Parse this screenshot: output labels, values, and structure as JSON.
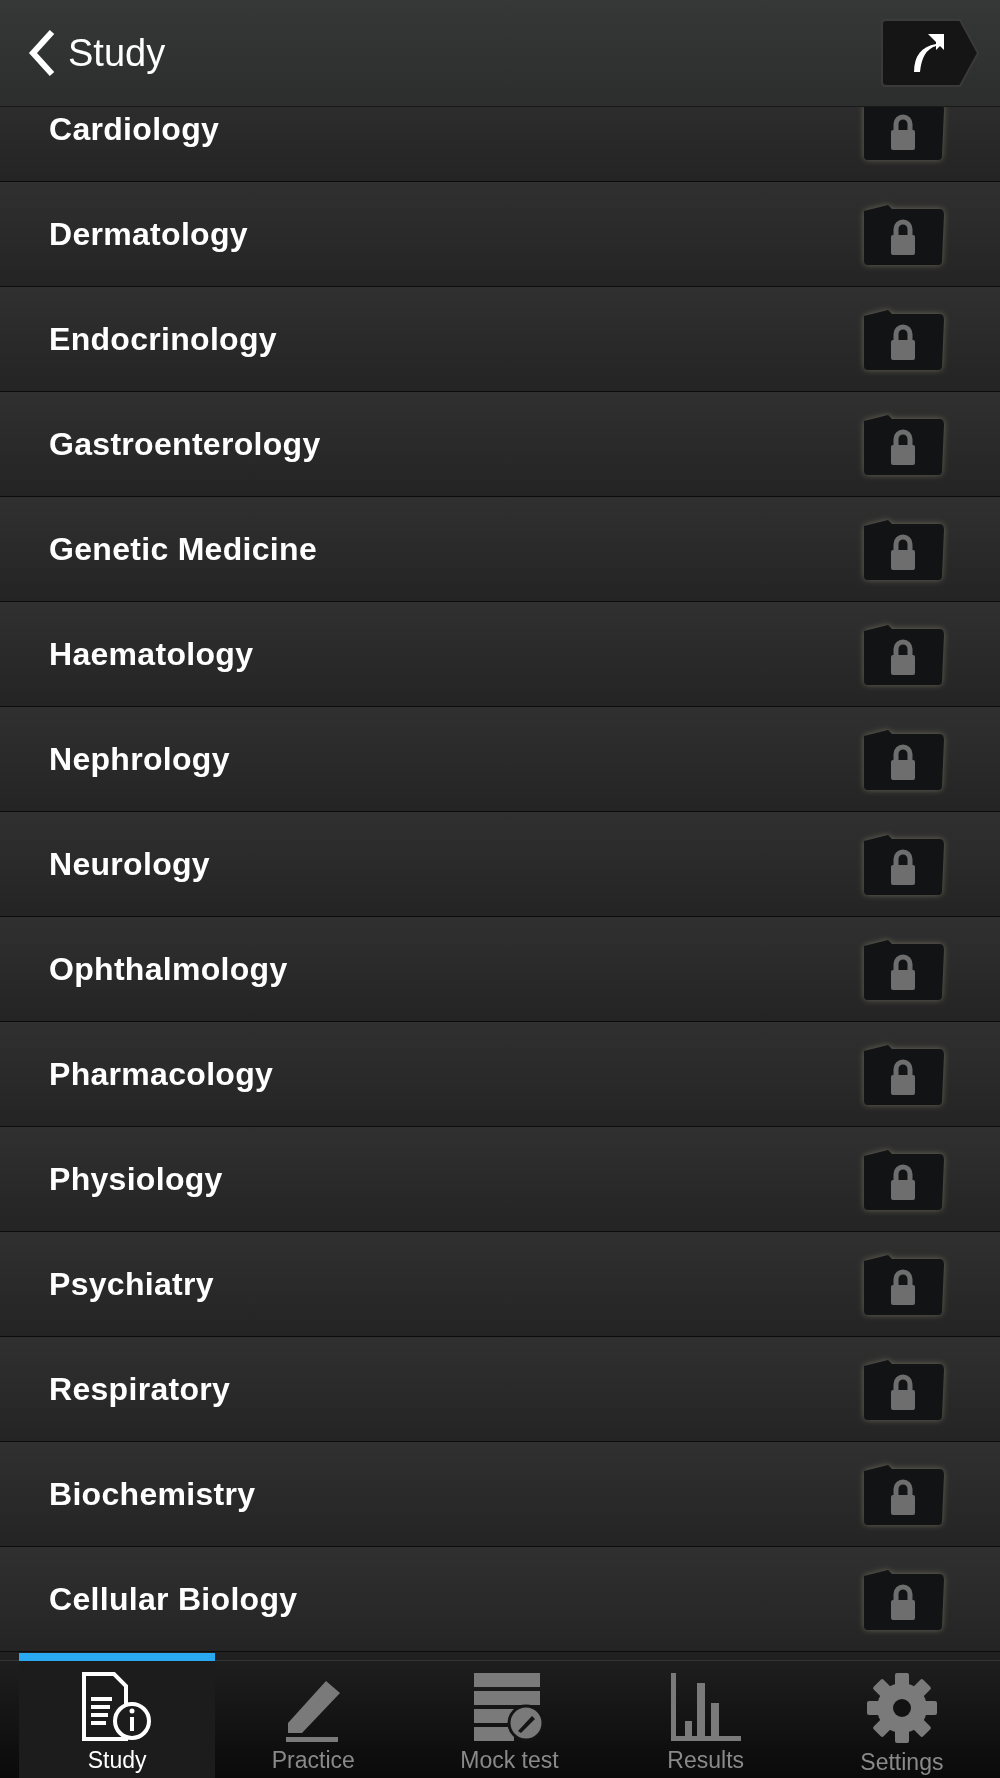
{
  "header": {
    "back_label": "Study"
  },
  "topics": [
    {
      "name": "Cardiology"
    },
    {
      "name": "Dermatology"
    },
    {
      "name": "Endocrinology"
    },
    {
      "name": "Gastroenterology"
    },
    {
      "name": "Genetic Medicine"
    },
    {
      "name": "Haematology"
    },
    {
      "name": "Nephrology"
    },
    {
      "name": "Neurology"
    },
    {
      "name": "Ophthalmology"
    },
    {
      "name": "Pharmacology"
    },
    {
      "name": "Physiology"
    },
    {
      "name": "Psychiatry"
    },
    {
      "name": "Respiratory"
    },
    {
      "name": "Biochemistry"
    },
    {
      "name": "Cellular Biology"
    }
  ],
  "tabs": [
    {
      "label": "Study",
      "selected": true
    },
    {
      "label": "Practice",
      "selected": false
    },
    {
      "label": "Mock test",
      "selected": false
    },
    {
      "label": "Results",
      "selected": false
    },
    {
      "label": "Settings",
      "selected": false
    }
  ]
}
